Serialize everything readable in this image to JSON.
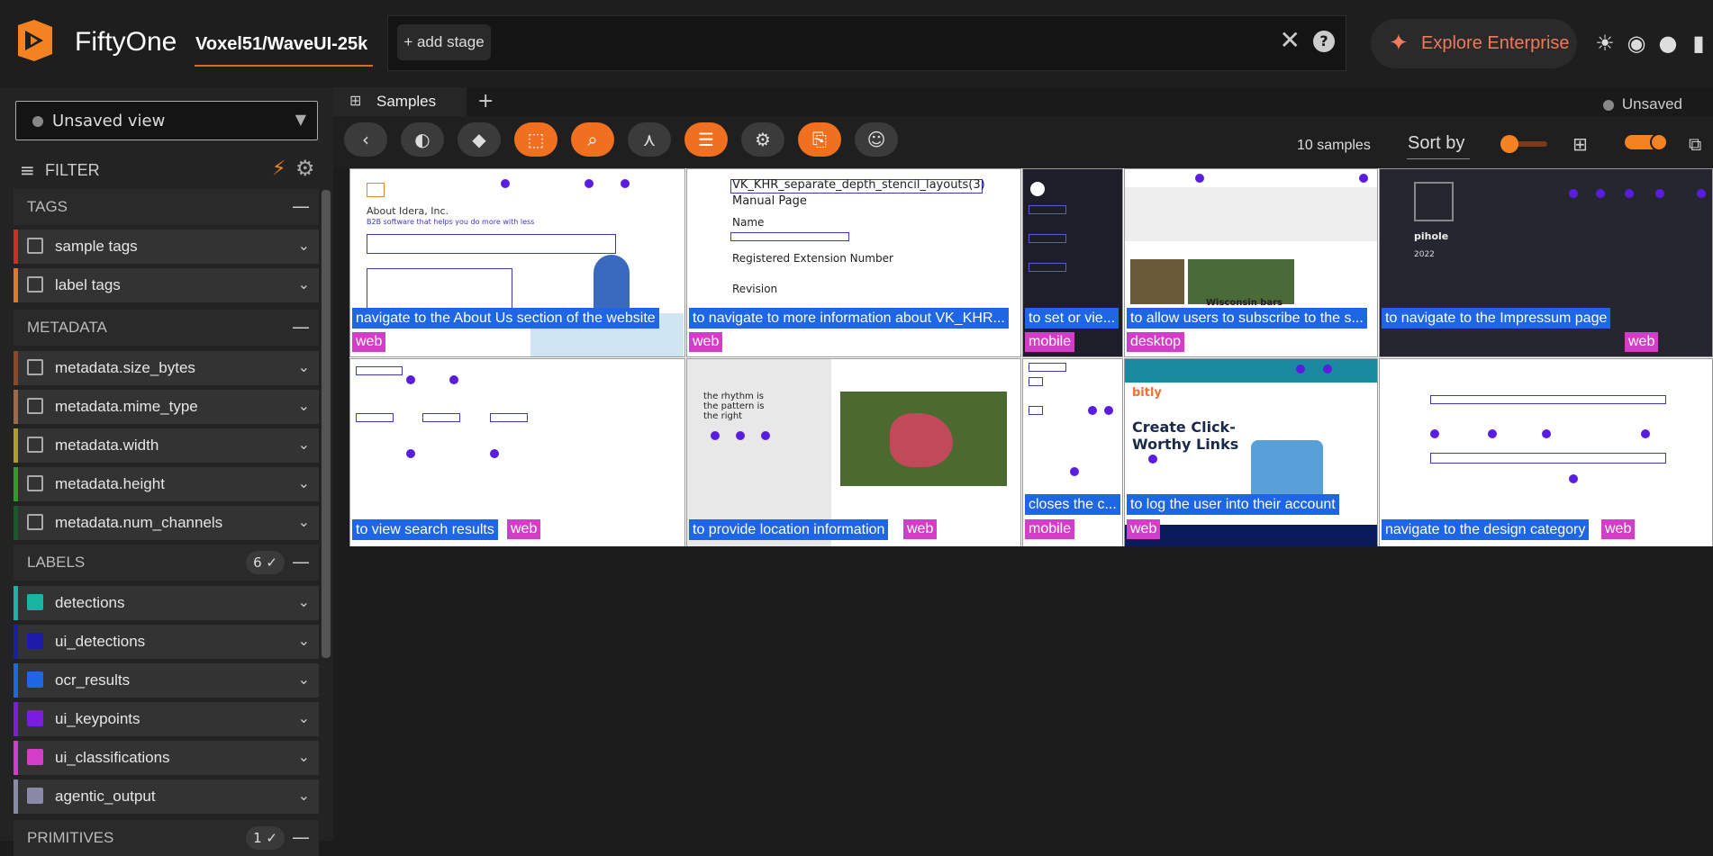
{
  "header": {
    "brand": "FiftyOne",
    "dataset": "Voxel51/WaveUI-25k",
    "add_stage": "+ add stage",
    "enterprise": "Explore Enterprise"
  },
  "sidebar": {
    "view": "Unsaved view",
    "filter": "FILTER",
    "sections": {
      "tags": "TAGS",
      "metadata": "METADATA",
      "labels": "LABELS",
      "labels_count": "6 ✓",
      "primitives": "PRIMITIVES",
      "primitives_count": "1 ✓"
    },
    "tag_items": [
      "sample tags",
      "label tags"
    ],
    "metadata_items": [
      "metadata.size_bytes",
      "metadata.mime_type",
      "metadata.width",
      "metadata.height",
      "metadata.num_channels"
    ],
    "label_items": [
      "detections",
      "ui_detections",
      "ocr_results",
      "ui_keypoints",
      "ui_classifications",
      "agentic_output"
    ]
  },
  "tabs": {
    "samples": "Samples",
    "unsaved": "Unsaved"
  },
  "toolbar": {
    "count": "10 samples",
    "sort_by": "Sort by"
  },
  "samples": [
    {
      "caption": "navigate to the About Us section of the website",
      "tag": "web"
    },
    {
      "caption": "to navigate to more information about VK_KHR...",
      "tag": "web"
    },
    {
      "caption": "to set or vie...",
      "tag": "mobile"
    },
    {
      "caption": "to allow users to subscribe to the s...",
      "tag": "desktop"
    },
    {
      "caption": "to navigate to the Impressum page",
      "tag": "web"
    },
    {
      "caption": "to view search results",
      "tag": "web"
    },
    {
      "caption": "to provide location information",
      "tag": "web"
    },
    {
      "caption": "closes the c...",
      "tag": "mobile"
    },
    {
      "caption": "to log the user into their account",
      "tag": "web"
    },
    {
      "caption": "navigate to the design category",
      "tag": "web"
    }
  ],
  "thumb_text": {
    "s1_title": "About Idera, Inc.",
    "s1_sub": "B2B software that helps you do more with less",
    "s2_title": "VK_KHR_separate_depth_stencil_layouts(3)",
    "s2_manual": "Manual Page",
    "s2_name": "Name",
    "s2_reg": "Registered Extension Number",
    "s2_rev": "Revision",
    "s4_headline": "Wisconsin bars reopen after lockdown lifted",
    "s5_title": "pihole",
    "s5_year": "2022",
    "s7_text": "the rhythm is the pattern is the right",
    "s9_brand": "bitly",
    "s9_headline": "Create Click-Worthy Links"
  },
  "colors": {
    "accent": "#f0701f",
    "caption_bg": "#1f66e5",
    "tag_bg": "#d43dc8",
    "label_bars": [
      "#1bb3a4",
      "#1c1ca8",
      "#1f66e5",
      "#7a1de0",
      "#d43dc8",
      "#8a8aa8"
    ]
  }
}
